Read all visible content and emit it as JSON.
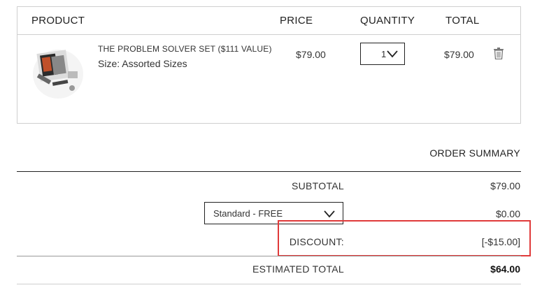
{
  "cart": {
    "headers": {
      "product": "PRODUCT",
      "price": "PRICE",
      "quantity": "QUANTITY",
      "total": "TOTAL"
    },
    "item": {
      "name": "THE PROBLEM SOLVER SET ($111 VALUE)",
      "size": "Size: Assorted Sizes",
      "price": "$79.00",
      "quantity": "1",
      "total": "$79.00",
      "thumbnail_icon": "product-thumbnail",
      "remove_icon": "trash-icon"
    }
  },
  "summary": {
    "title": "ORDER SUMMARY",
    "subtotal_label": "SUBTOTAL",
    "subtotal_value": "$79.00",
    "shipping_option": "Standard - FREE",
    "shipping_value": "$0.00",
    "discount_label": "DISCOUNT:",
    "discount_value": "[-$15.00]",
    "estimated_total_label": "ESTIMATED TOTAL",
    "estimated_total_value": "$64.00"
  },
  "colors": {
    "highlight_border": "#e03a3a",
    "text": "#222222",
    "border": "#cfcfcf"
  }
}
